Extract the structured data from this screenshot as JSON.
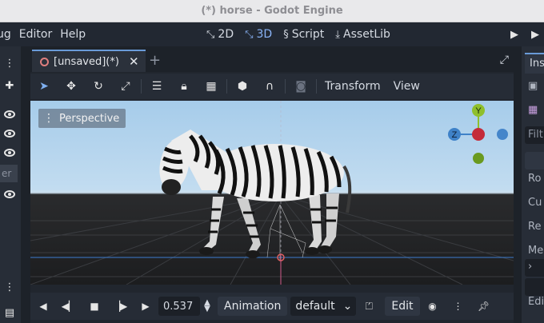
{
  "window": {
    "title": "(*) horse - Godot Engine"
  },
  "menu": {
    "items": [
      "ug",
      "Editor",
      "Help"
    ]
  },
  "workspaces": [
    {
      "label": "2D",
      "icon": "2d-icon",
      "active": false
    },
    {
      "label": "3D",
      "icon": "3d-icon",
      "active": true
    },
    {
      "label": "Script",
      "icon": "script-icon",
      "active": false
    },
    {
      "label": "AssetLib",
      "icon": "assetlib-icon",
      "active": false
    }
  ],
  "scene_tab": {
    "label": "[unsaved](*)"
  },
  "toolbar": {
    "transform_label": "Transform",
    "view_label": "View"
  },
  "viewport": {
    "label": "Perspective",
    "gizmo": {
      "x": "",
      "y": "Y",
      "z": "Z"
    }
  },
  "animation": {
    "time": "0.537",
    "animation_label": "Animation",
    "selected": "default",
    "edit_label": "Edit"
  },
  "inspector": {
    "tab_label": "Ins",
    "filter_placeholder": "Filt",
    "rows": [
      "Ro",
      "Cu",
      "Re",
      "Me",
      "Edi"
    ]
  },
  "left_dock": {
    "selected_fragment": "er"
  },
  "colors": {
    "accent": "#6a9bd8",
    "axis_x": "#c42b3a",
    "axis_y": "#8fbf2c",
    "axis_z": "#3f82c8"
  }
}
